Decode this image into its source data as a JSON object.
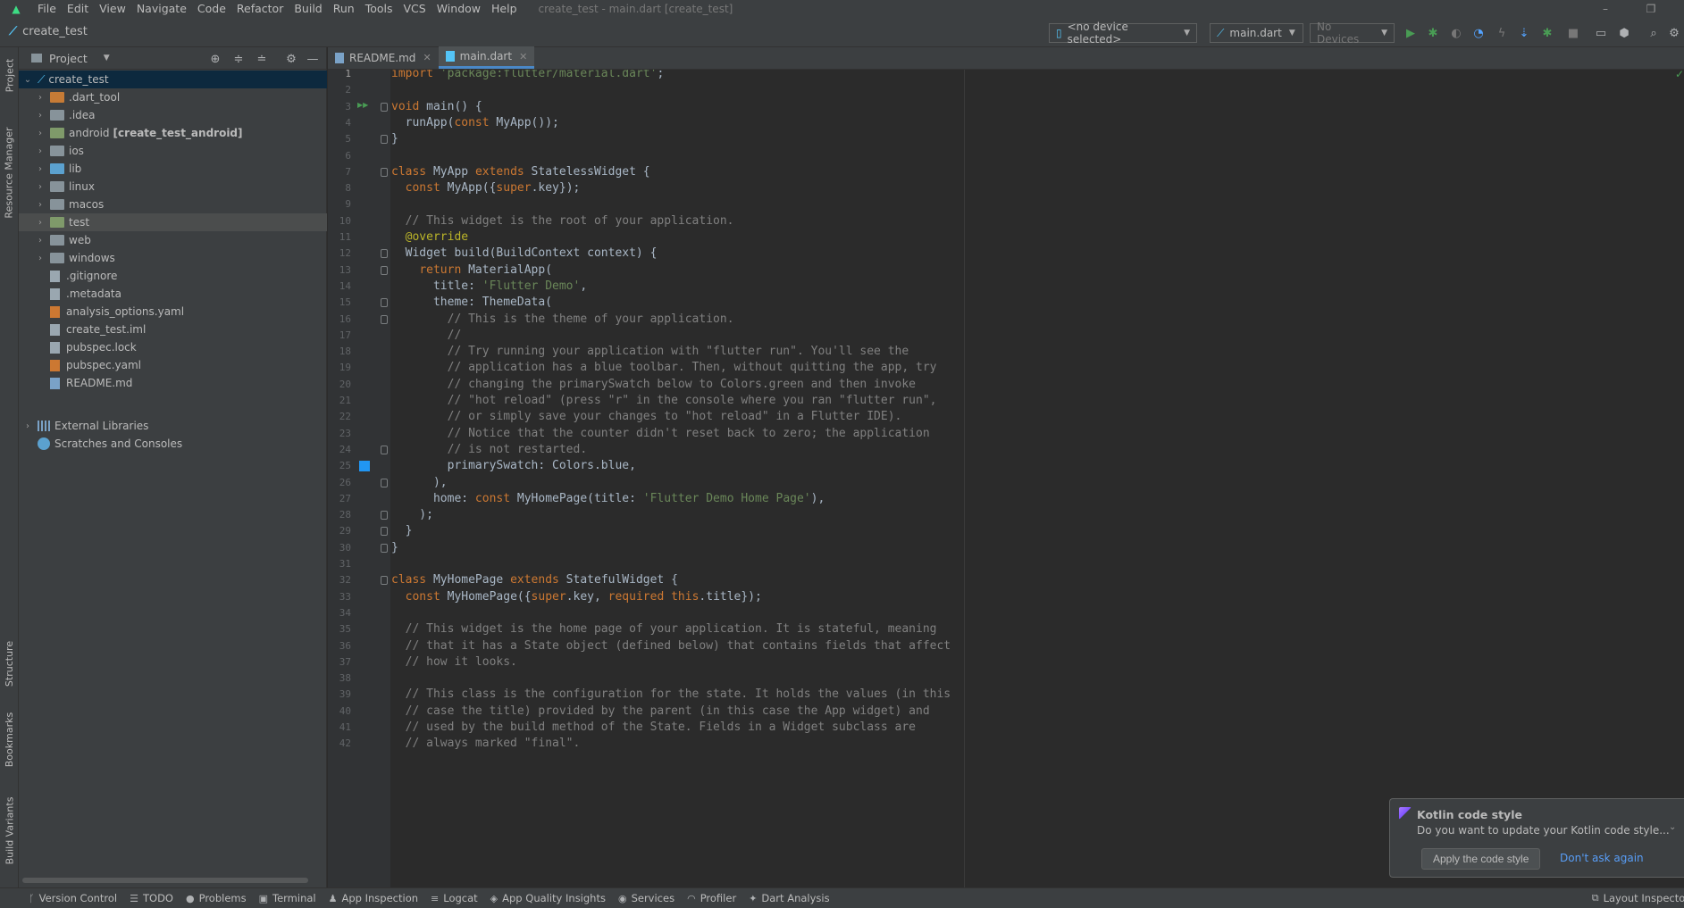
{
  "menubar": {
    "logo": "android-logo",
    "items": [
      "File",
      "Edit",
      "View",
      "Navigate",
      "Code",
      "Refactor",
      "Build",
      "Run",
      "Tools",
      "VCS",
      "Window",
      "Help"
    ],
    "window_title": "create_test - main.dart [create_test]",
    "window_controls": [
      "–",
      "❐"
    ]
  },
  "navbar": {
    "project_name": "create_test",
    "device_selector": "<no device selected>",
    "run_config": "main.dart",
    "devices_combo": "No Devices"
  },
  "left_strip": {
    "tabs": [
      "Project",
      "Resource Manager",
      "Structure",
      "Bookmarks",
      "Build Variants"
    ]
  },
  "project_panel": {
    "header": "Project",
    "root": "create_test",
    "items": [
      {
        "label": ".dart_tool",
        "type": "folder-orange"
      },
      {
        "label": ".idea",
        "type": "folder"
      },
      {
        "label": "android",
        "extra": "[create_test_android]",
        "type": "folder-green"
      },
      {
        "label": "ios",
        "type": "folder"
      },
      {
        "label": "lib",
        "type": "folder-blue"
      },
      {
        "label": "linux",
        "type": "folder"
      },
      {
        "label": "macos",
        "type": "folder"
      },
      {
        "label": "test",
        "type": "folder-green"
      },
      {
        "label": "web",
        "type": "folder"
      },
      {
        "label": "windows",
        "type": "folder"
      },
      {
        "label": ".gitignore",
        "type": "file"
      },
      {
        "label": ".metadata",
        "type": "file"
      },
      {
        "label": "analysis_options.yaml",
        "type": "yaml"
      },
      {
        "label": "create_test.iml",
        "type": "file"
      },
      {
        "label": "pubspec.lock",
        "type": "file"
      },
      {
        "label": "pubspec.yaml",
        "type": "yaml"
      },
      {
        "label": "README.md",
        "type": "md"
      }
    ],
    "external_libraries": "External Libraries",
    "scratches": "Scratches and Consoles"
  },
  "editor_tabs": [
    {
      "label": "README.md",
      "active": false
    },
    {
      "label": "main.dart",
      "active": true
    }
  ],
  "editor": {
    "lines": [
      "import 'package:flutter/material.dart';",
      "",
      "void main() {",
      "  runApp(const MyApp());",
      "}",
      "",
      "class MyApp extends StatelessWidget {",
      "  const MyApp({super.key});",
      "",
      "  // This widget is the root of your application.",
      "  @override",
      "  Widget build(BuildContext context) {",
      "    return MaterialApp(",
      "      title: 'Flutter Demo',",
      "      theme: ThemeData(",
      "        // This is the theme of your application.",
      "        //",
      "        // Try running your application with \"flutter run\". You'll see the",
      "        // application has a blue toolbar. Then, without quitting the app, try",
      "        // changing the primarySwatch below to Colors.green and then invoke",
      "        // \"hot reload\" (press \"r\" in the console where you ran \"flutter run\",",
      "        // or simply save your changes to \"hot reload\" in a Flutter IDE).",
      "        // Notice that the counter didn't reset back to zero; the application",
      "        // is not restarted.",
      "        primarySwatch: Colors.blue,",
      "      ),",
      "      home: const MyHomePage(title: 'Flutter Demo Home Page'),",
      "    );",
      "  }",
      "}",
      "",
      "class MyHomePage extends StatefulWidget {",
      "  const MyHomePage({super.key, required this.title});",
      "",
      "  // This widget is the home page of your application. It is stateful, meaning",
      "  // that it has a State object (defined below) that contains fields that affect",
      "  // how it looks.",
      "",
      "  // This class is the configuration for the state. It holds the values (in this",
      "  // case the title) provided by the parent (in this case the App widget) and",
      "  // used by the build method of the State. Fields in a Widget subclass are",
      "  // always marked \"final\"."
    ]
  },
  "notification": {
    "title": "Kotlin code style",
    "body": "Do you want to update your Kotlin code style...",
    "primary_button": "Apply the code style",
    "secondary_link": "Don't ask again"
  },
  "bottom_bar": {
    "items": [
      {
        "label": "Version Control",
        "icon": "branch-icon"
      },
      {
        "label": "TODO",
        "icon": "list-icon"
      },
      {
        "label": "Problems",
        "icon": "info-icon"
      },
      {
        "label": "Terminal",
        "icon": "terminal-icon"
      },
      {
        "label": "App Inspection",
        "icon": "inspection-icon"
      },
      {
        "label": "Logcat",
        "icon": "logcat-icon"
      },
      {
        "label": "App Quality Insights",
        "icon": "quality-icon"
      },
      {
        "label": "Services",
        "icon": "services-icon"
      },
      {
        "label": "Profiler",
        "icon": "profiler-icon"
      },
      {
        "label": "Dart Analysis",
        "icon": "dart-icon"
      }
    ],
    "right_item": "Layout Inspector"
  }
}
